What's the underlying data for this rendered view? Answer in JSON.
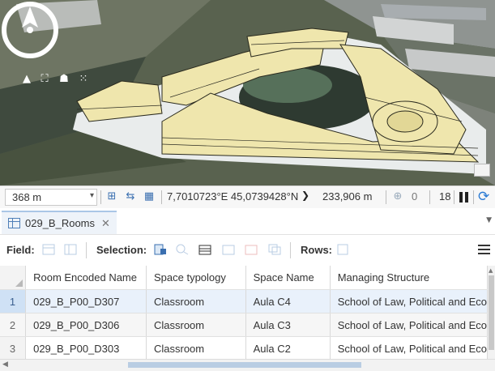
{
  "scene": {
    "nav_icons": [
      "up-arrow-icon",
      "fullscreen-icon",
      "walk-icon",
      "grid-dots-icon"
    ],
    "compass": "north-compass-icon",
    "corner_icon": "table-icon"
  },
  "statusbar": {
    "scale": "368 m",
    "coords": "7,7010723°E 45,0739428°N",
    "elevation": "233,906 m",
    "selected_count": "0",
    "fps": "18"
  },
  "tab": {
    "label": "029_B_Rooms",
    "close": "✕"
  },
  "toolbar": {
    "field_label": "Field:",
    "selection_label": "Selection:",
    "rows_label": "Rows:"
  },
  "table": {
    "columns": [
      "Room Encoded Name",
      "Space typology",
      "Space Name",
      "Managing Structure"
    ],
    "rows": [
      {
        "num": "1",
        "cells": [
          "029_B_P00_D307",
          "Classroom",
          "Aula C4",
          "School of Law, Political and Eco"
        ]
      },
      {
        "num": "2",
        "cells": [
          "029_B_P00_D306",
          "Classroom",
          "Aula C3",
          "School of Law, Political and Eco"
        ]
      },
      {
        "num": "3",
        "cells": [
          "029_B_P00_D303",
          "Classroom",
          "Aula C2",
          "School of Law, Political and Eco"
        ]
      }
    ]
  },
  "colors": {
    "accent": "#3a6fb0",
    "building": "#efe6ad",
    "refresh": "#2b7bd4"
  }
}
